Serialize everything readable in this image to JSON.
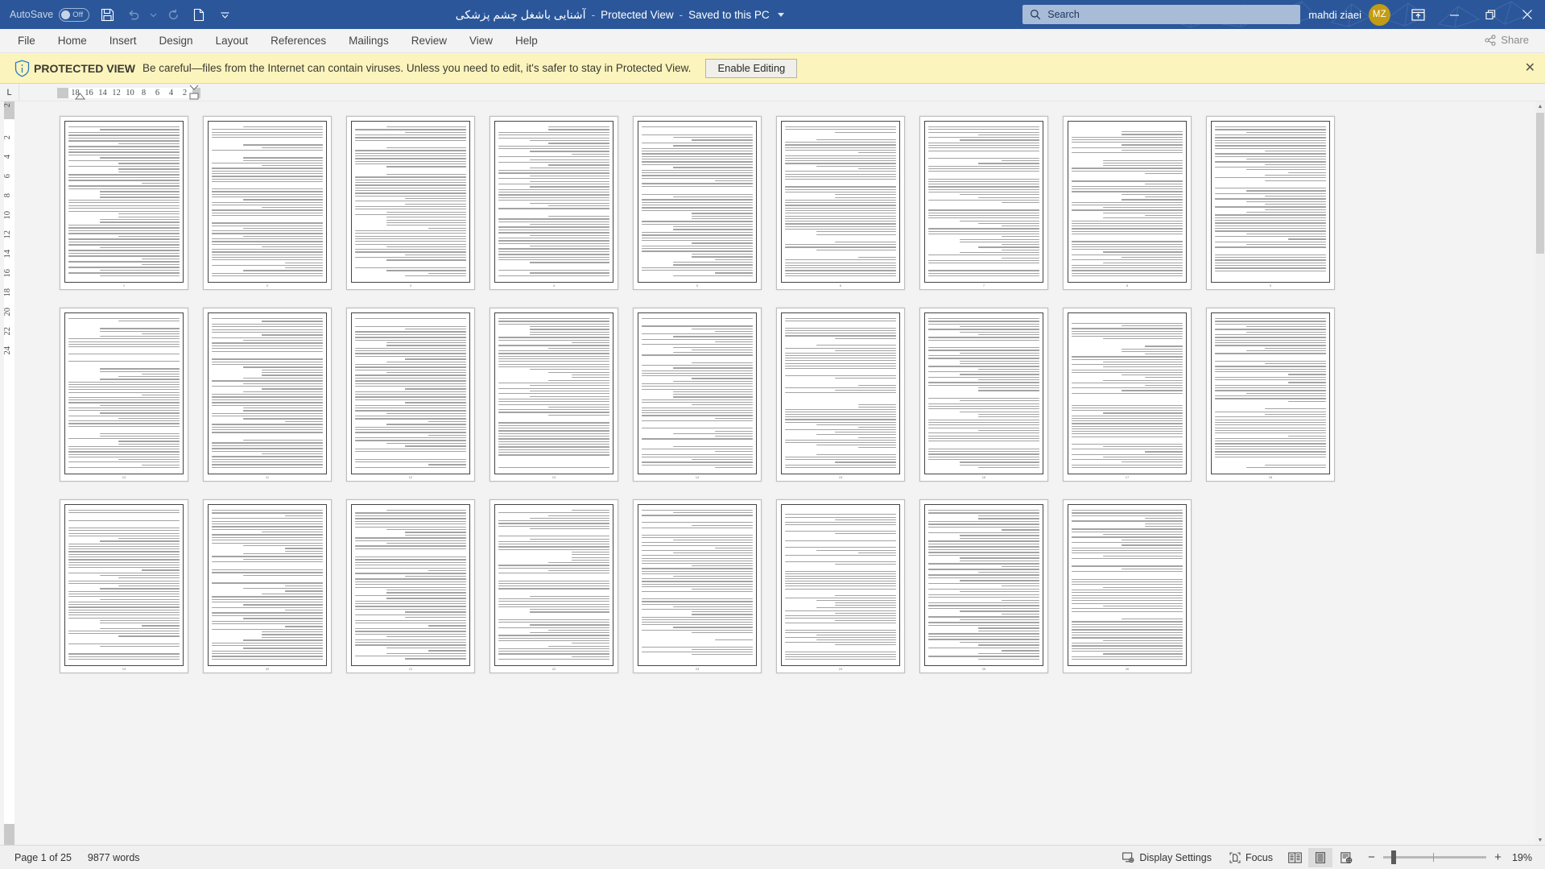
{
  "titlebar": {
    "autosave_label": "AutoSave",
    "autosave_state": "Off",
    "save_icon": "save-icon",
    "undo_icon": "undo-icon",
    "redo_icon": "redo-icon",
    "new_icon": "new-document-icon",
    "customize_icon": "customize-quick-access-icon",
    "document_name": "آشنایی باشغل چشم پزشکی",
    "separator": "-",
    "protected_view": "Protected View",
    "save_location": "Saved to this PC",
    "search_placeholder": "Search",
    "search_icon": "search-icon",
    "user_name": "mahdi ziaei",
    "user_initials": "MZ",
    "ribbon_display_icon": "ribbon-display-options-icon",
    "minimize_icon": "minimize-icon",
    "restore_icon": "restore-icon",
    "close_icon": "close-icon"
  },
  "ribbon": {
    "tabs": [
      {
        "label": "File"
      },
      {
        "label": "Home"
      },
      {
        "label": "Insert"
      },
      {
        "label": "Design"
      },
      {
        "label": "Layout"
      },
      {
        "label": "References"
      },
      {
        "label": "Mailings"
      },
      {
        "label": "Review"
      },
      {
        "label": "View"
      },
      {
        "label": "Help"
      }
    ],
    "share_label": "Share",
    "share_icon": "share-icon"
  },
  "protected_view": {
    "icon": "shield-info-icon",
    "title": "PROTECTED VIEW",
    "message": "Be careful—files from the Internet can contain viruses. Unless you need to edit, it's safer to stay in Protected View.",
    "enable_button": "Enable Editing",
    "close_icon": "close-banner-icon"
  },
  "ruler": {
    "tabstop_marker": "L",
    "horizontal_ticks": [
      "18",
      "16",
      "14",
      "12",
      "10",
      "8",
      "6",
      "4",
      "2"
    ],
    "vertical_ticks": [
      "2",
      "2",
      "4",
      "6",
      "8",
      "10",
      "12",
      "14",
      "16",
      "18",
      "20",
      "22",
      "24"
    ]
  },
  "document": {
    "language": "fa",
    "direction": "rtl",
    "visible_pages": 26,
    "columns": 9,
    "page_numbers": [
      "1",
      "2",
      "3",
      "4",
      "5",
      "6",
      "7",
      "8",
      "9",
      "10",
      "11",
      "12",
      "13",
      "14",
      "15",
      "16",
      "17",
      "18",
      "19",
      "20",
      "21",
      "22",
      "23",
      "24",
      "25",
      "26"
    ]
  },
  "statusbar": {
    "page_label": "Page 1 of 25",
    "word_count": "9877 words",
    "display_settings_label": "Display Settings",
    "display_settings_icon": "display-settings-icon",
    "focus_label": "Focus",
    "focus_icon": "focus-mode-icon",
    "read_mode_icon": "read-mode-icon",
    "print_layout_icon": "print-layout-icon",
    "web_layout_icon": "web-layout-icon",
    "zoom_out_label": "−",
    "zoom_in_label": "+",
    "zoom_level": "19%"
  },
  "colors": {
    "title_bar": "#2b579a",
    "accent": "#2b579a",
    "banner_bg": "#fcf4bd",
    "avatar": "#c19c14",
    "chrome_bg": "#f3f3f3"
  }
}
